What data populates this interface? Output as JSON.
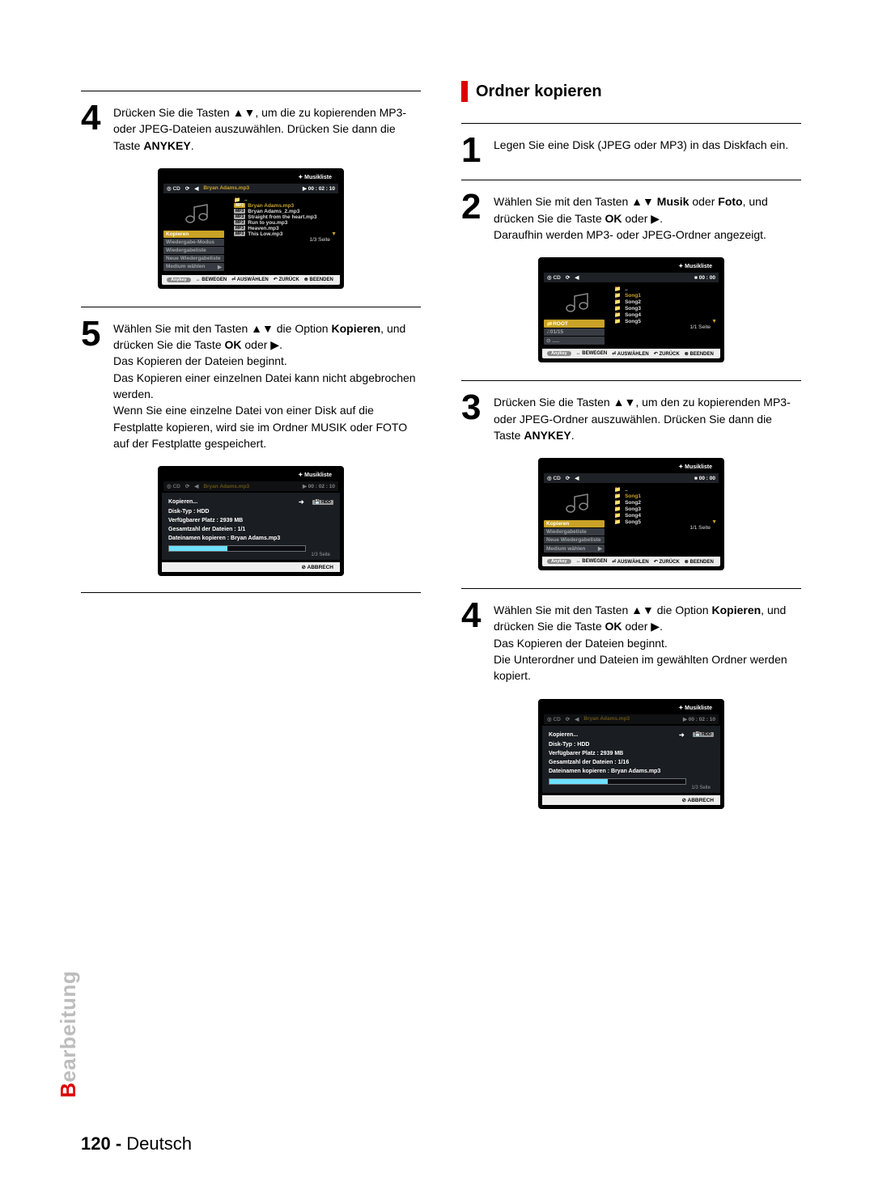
{
  "sideTab": {
    "accent": "B",
    "rest": "earbeitung"
  },
  "footer": {
    "pageNum": "120 -",
    "lang": "Deutsch"
  },
  "left": {
    "step4": {
      "num": "4",
      "text_a": "Drücken Sie die Tasten ▲▼, um die zu kopierenden MP3- oder JPEG-Dateien auszuwählen. Drücken Sie dann die Taste ",
      "text_b_bold": "ANYKEY",
      "text_c": "."
    },
    "step5": {
      "num": "5",
      "line1_a": "Wählen Sie mit den Tasten ▲▼ die Option ",
      "line1_b_bold": "Kopieren",
      "line1_c": ", und drücken Sie die Taste ",
      "line1_d_bold": "OK",
      "line1_e": " oder ▶.",
      "line2": "Das Kopieren der Dateien beginnt.",
      "line3": "Das Kopieren einer einzelnen Datei kann nicht abgebrochen werden.",
      "line4": "Wenn Sie eine einzelne Datei von einer Disk auf die Festplatte kopieren, wird sie im Ordner MUSIK oder FOTO auf der Festplatte gespeichert."
    }
  },
  "right": {
    "sectionTitle": "Ordner kopieren",
    "step1": {
      "num": "1",
      "text": "Legen Sie eine Disk (JPEG oder MP3) in das Diskfach ein."
    },
    "step2": {
      "num": "2",
      "a": "Wählen Sie mit den Tasten ▲▼ ",
      "b_bold": "Musik",
      "c": " oder ",
      "d_bold": "Foto",
      "e": ", und drücken Sie die Taste ",
      "f_bold": "OK",
      "g": " oder ▶.",
      "h": "Daraufhin werden MP3- oder JPEG-Ordner angezeigt."
    },
    "step3": {
      "num": "3",
      "a": "Drücken Sie die Tasten ▲▼, um den zu kopierenden MP3- oder JPEG-Ordner auszuwählen. Drücken Sie dann die Taste ",
      "b_bold": "ANYKEY",
      "c": "."
    },
    "step4": {
      "num": "4",
      "a": "Wählen Sie mit den Tasten ▲▼ die Option ",
      "b_bold": "Kopieren",
      "c": ", und drücken Sie die Taste ",
      "d_bold": "OK",
      "e": " oder ▶.",
      "f": "Das Kopieren der Dateien beginnt.",
      "g": "Die Unterordner und Dateien im gewählten Ordner werden kopiert."
    }
  },
  "screens": {
    "musikliste": "Musikliste",
    "cd": "CD",
    "nowPlaying": "Bryan Adams.mp3",
    "time1": "00 : 02 : 10",
    "time0": "00 : 00",
    "kopieren": "Kopieren",
    "wiedergabeModus": "Wiedergabe-Modus",
    "wiedergabeliste": "Wiedergabeliste",
    "neueWiedergabeliste": "Neue Wiedergabeliste",
    "mediumWaehlen": "Medium wählen",
    "root": "ROOT",
    "counter": "01/15",
    "seite13": "1/3 Seite",
    "seite11": "1/1 Seite",
    "footer": {
      "anykey": "Anykey",
      "bewegen": "BEWEGEN",
      "auswaehlen": "AUSWÄHLEN",
      "zurueck": "ZURÜCK",
      "beenden": "BEENDEN"
    },
    "files": {
      "up": "..",
      "f1": "Bryan Adams.mp3",
      "f2": "Bryan Adams_2.mp3",
      "f3": "Straight from the heart.mp3",
      "f4": "Run to you.mp3",
      "f5": "Heaven.mp3",
      "f6": "This Low.mp3"
    },
    "songs": {
      "s1": "Song1",
      "s2": "Song2",
      "s3": "Song3",
      "s4": "Song4",
      "s5": "Song5"
    },
    "copy": {
      "title": "Kopieren...",
      "hdd": "HDD",
      "diskTyp": "Disk-Typ : HDD",
      "platz": "Verfügbarer Platz : 2939 MB",
      "gesamt1": "Gesamtzahl der Dateien : 1/1",
      "gesamt16": "Gesamtzahl der Dateien : 1/16",
      "datei": "Dateinamen kopieren : Bryan Adams.mp3",
      "percent": "43 %",
      "abbrech": "ABBRECH"
    }
  }
}
